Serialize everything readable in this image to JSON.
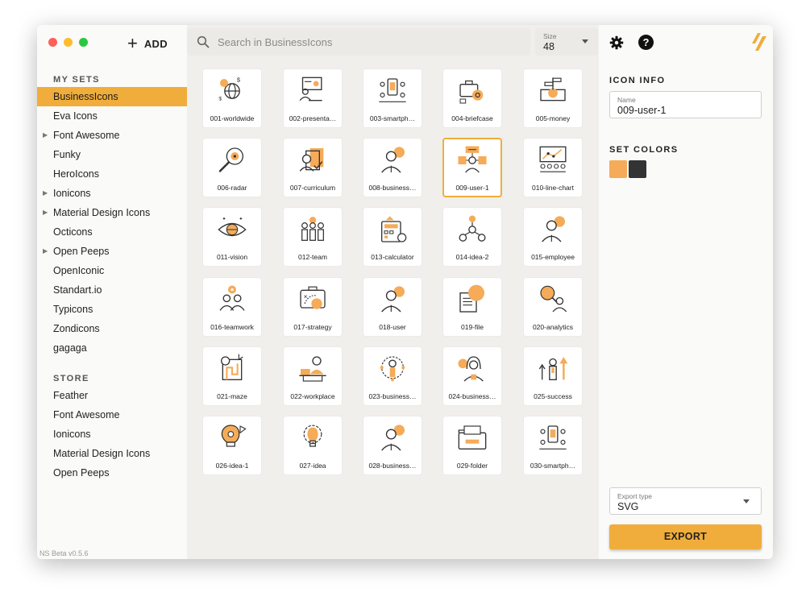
{
  "colors": {
    "accent": "#f0ad3b",
    "dark": "#333333",
    "close": "#ff5f57",
    "minimize": "#febc2e",
    "zoom": "#28c840"
  },
  "toolbar": {
    "add_label": "ADD"
  },
  "search": {
    "placeholder": "Search in BusinessIcons"
  },
  "size": {
    "label": "Size",
    "value": "48"
  },
  "sidebar": {
    "my_sets_title": "MY SETS",
    "my_sets": [
      {
        "label": "BusinessIcons",
        "expandable": false,
        "active": true
      },
      {
        "label": "Eva Icons",
        "expandable": false,
        "active": false
      },
      {
        "label": "Font Awesome",
        "expandable": true,
        "active": false
      },
      {
        "label": "Funky",
        "expandable": false,
        "active": false
      },
      {
        "label": "HeroIcons",
        "expandable": false,
        "active": false
      },
      {
        "label": "Ionicons",
        "expandable": true,
        "active": false
      },
      {
        "label": "Material Design Icons",
        "expandable": true,
        "active": false
      },
      {
        "label": "Octicons",
        "expandable": false,
        "active": false
      },
      {
        "label": "Open Peeps",
        "expandable": true,
        "active": false
      },
      {
        "label": "OpenIconic",
        "expandable": false,
        "active": false
      },
      {
        "label": "Standart.io",
        "expandable": false,
        "active": false
      },
      {
        "label": "Typicons",
        "expandable": false,
        "active": false
      },
      {
        "label": "Zondicons",
        "expandable": false,
        "active": false
      },
      {
        "label": "gagaga",
        "expandable": false,
        "active": false
      }
    ],
    "store_title": "STORE",
    "store": [
      {
        "label": "Feather"
      },
      {
        "label": "Font Awesome"
      },
      {
        "label": "Ionicons"
      },
      {
        "label": "Material Design Icons"
      },
      {
        "label": "Open Peeps"
      }
    ],
    "version": "NS Beta v0.5.6"
  },
  "icons": [
    {
      "label": "001-worldwide",
      "kind": "globe"
    },
    {
      "label": "002-presenta…",
      "kind": "presentation"
    },
    {
      "label": "003-smartph…",
      "kind": "phone"
    },
    {
      "label": "004-briefcase",
      "kind": "briefcase"
    },
    {
      "label": "005-money",
      "kind": "money"
    },
    {
      "label": "006-radar",
      "kind": "radar"
    },
    {
      "label": "007-curriculum",
      "kind": "document"
    },
    {
      "label": "008-business…",
      "kind": "person"
    },
    {
      "label": "009-user-1",
      "kind": "user",
      "selected": true
    },
    {
      "label": "010-line-chart",
      "kind": "chart"
    },
    {
      "label": "011-vision",
      "kind": "eye"
    },
    {
      "label": "012-team",
      "kind": "team"
    },
    {
      "label": "013-calculator",
      "kind": "calculator"
    },
    {
      "label": "014-idea-2",
      "kind": "network"
    },
    {
      "label": "015-employee",
      "kind": "person"
    },
    {
      "label": "016-teamwork",
      "kind": "teamwork"
    },
    {
      "label": "017-strategy",
      "kind": "strategy"
    },
    {
      "label": "018-user",
      "kind": "person"
    },
    {
      "label": "019-file",
      "kind": "file"
    },
    {
      "label": "020-analytics",
      "kind": "analytics"
    },
    {
      "label": "021-maze",
      "kind": "maze"
    },
    {
      "label": "022-workplace",
      "kind": "workplace"
    },
    {
      "label": "023-business…",
      "kind": "target"
    },
    {
      "label": "024-business…",
      "kind": "woman"
    },
    {
      "label": "025-success",
      "kind": "success"
    },
    {
      "label": "026-idea-1",
      "kind": "bulb"
    },
    {
      "label": "027-idea",
      "kind": "gearbulb"
    },
    {
      "label": "028-business…",
      "kind": "person"
    },
    {
      "label": "029-folder",
      "kind": "folder"
    },
    {
      "label": "030-smartph…",
      "kind": "phone"
    }
  ],
  "right_panel": {
    "icon_info_title": "ICON INFO",
    "name_label": "Name",
    "name_value": "009-user-1",
    "set_colors_title": "SET COLORS",
    "export_type_label": "Export type",
    "export_type_value": "SVG",
    "export_label": "EXPORT"
  }
}
